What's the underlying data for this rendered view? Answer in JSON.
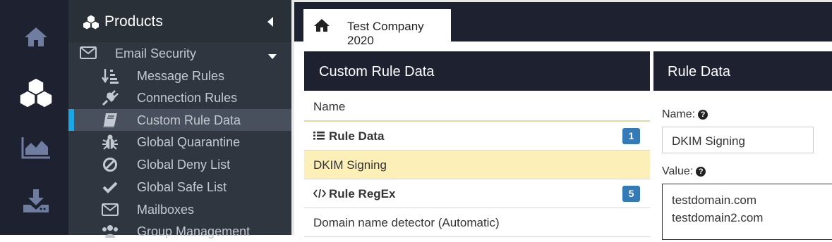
{
  "sidebar": {
    "title": "Products",
    "section": {
      "label": "Email Security"
    },
    "items": [
      {
        "label": "Message Rules",
        "icon": "sort-list-icon"
      },
      {
        "label": "Connection Rules",
        "icon": "plug-icon"
      },
      {
        "label": "Custom Rule Data",
        "icon": "book-icon",
        "active": true
      },
      {
        "label": "Global Quarantine",
        "icon": "bug-icon"
      },
      {
        "label": "Global Deny List",
        "icon": "ban-icon"
      },
      {
        "label": "Global Safe List",
        "icon": "check-icon"
      },
      {
        "label": "Mailboxes",
        "icon": "envelope-icon"
      },
      {
        "label": "Group Management",
        "icon": "users-icon"
      }
    ]
  },
  "tab": {
    "label": "Test Company 2020"
  },
  "custom_rule_panel": {
    "title": "Custom Rule Data",
    "column_header": "Name",
    "groups": [
      {
        "label": "Rule Data",
        "count": "1",
        "icon": "list-icon"
      },
      {
        "label": "Rule RegEx",
        "count": "5",
        "icon": "code-icon"
      }
    ],
    "rows": [
      {
        "label": "DKIM Signing",
        "selected": true
      },
      {
        "label": "Domain name detector (Automatic)",
        "selected": false
      }
    ]
  },
  "rule_data_panel": {
    "title": "Rule Data",
    "name_label": "Name:",
    "name_value": "DKIM Signing",
    "value_label": "Value:",
    "value_lines": "testdomain.com\ntestdomain2.com"
  },
  "colors": {
    "accent": "#1ca6e6",
    "dark": "#1e2130",
    "sidebar": "#2f3640",
    "selected_row": "#fcefb8",
    "badge": "#337ab7"
  }
}
